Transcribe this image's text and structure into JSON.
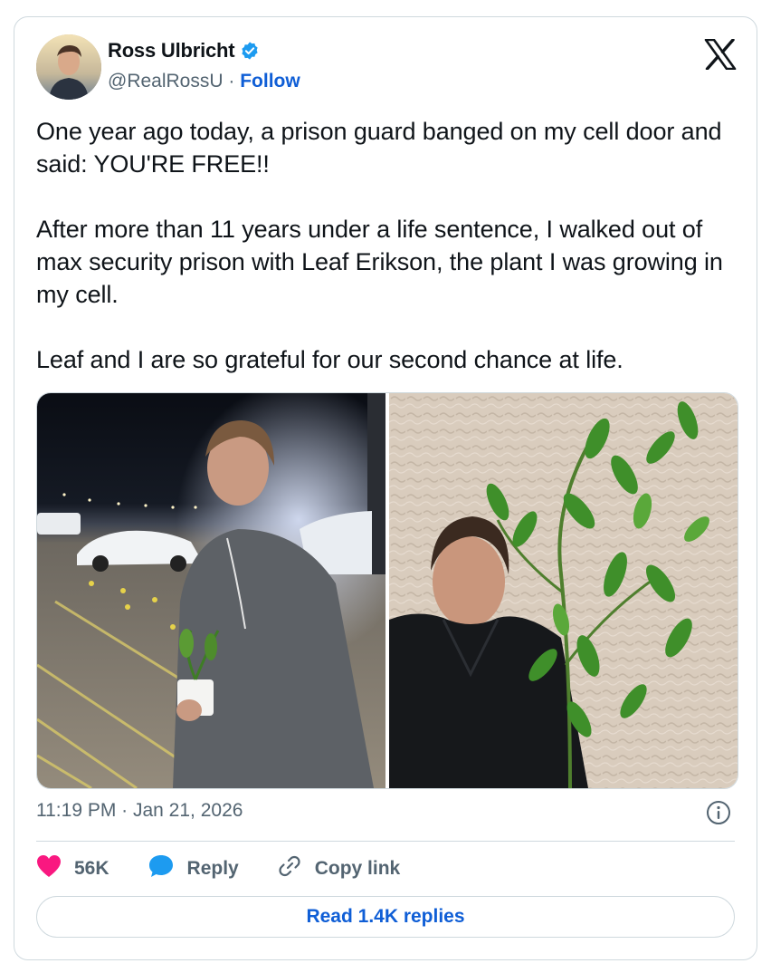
{
  "author": {
    "name": "Ross Ulbricht",
    "handle": "@RealRossU",
    "separator": "·",
    "follow_label": "Follow",
    "verified": true,
    "avatar_icon": "avatar-photo"
  },
  "brand_icon": "x-logo-icon",
  "tweet": {
    "text": "One year ago today, a prison guard banged on my cell door and said: YOU'RE FREE!!\n\nAfter more than 11 years under a life sentence, I walked out of max security prison with Leaf Erikson, the plant I was growing in my cell.\n\nLeaf and I are so grateful for our second chance at life.",
    "timestamp": "11:19 PM · Jan 21, 2026"
  },
  "media": [
    {
      "description_icon": "photo-parking-lot-night"
    },
    {
      "description_icon": "photo-plant-indoor"
    }
  ],
  "actions": {
    "like_count": "56K",
    "reply_label": "Reply",
    "copy_link_label": "Copy link",
    "read_replies_label": "Read 1.4K replies"
  },
  "colors": {
    "accent": "#1d9bf0",
    "link": "#0f5ed6",
    "like": "#f91880",
    "muted": "#536471",
    "border": "#cfd9de"
  }
}
